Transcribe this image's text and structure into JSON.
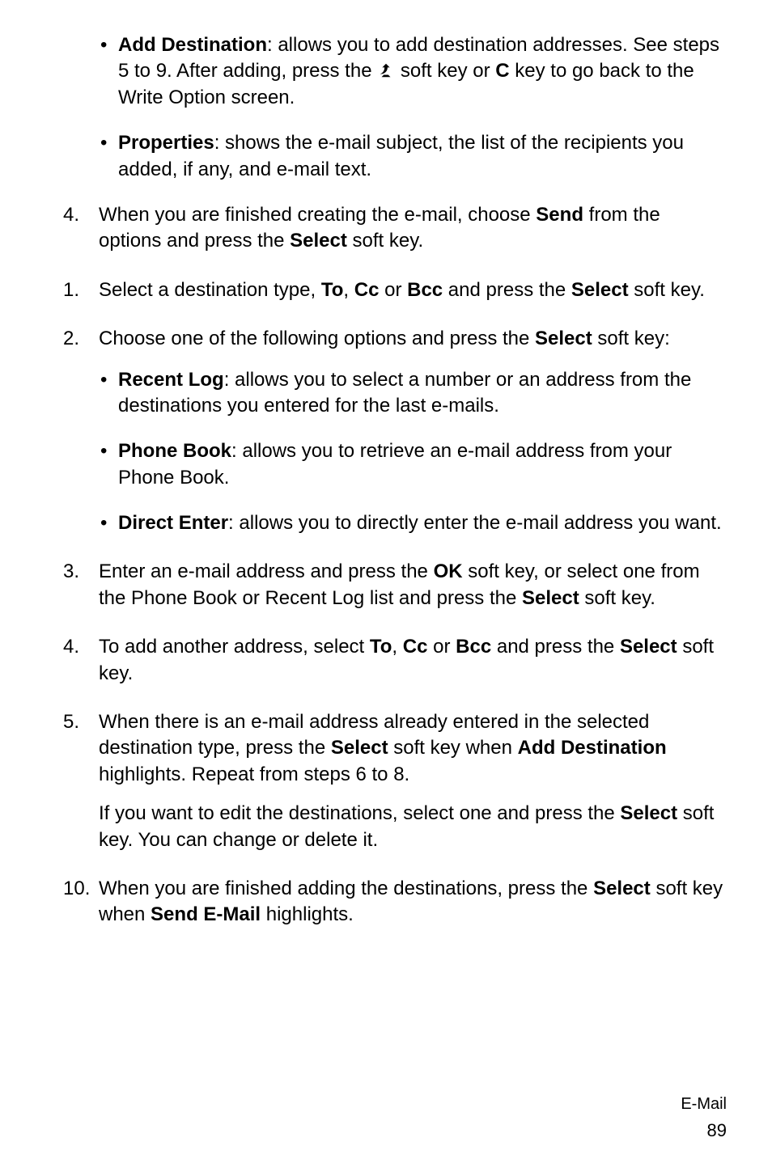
{
  "top_bullets": [
    {
      "title": "Add Destination",
      "tail1": ": allows you to add destination addresses. See steps 5 to 9. After adding, press the ",
      "tail2": " soft key or ",
      "key": "C",
      "tail3": " key to go back to the Write Option screen."
    },
    {
      "title": "Properties",
      "tail": ": shows the e-mail subject, the list of the recipients you added, if any, and e-mail text."
    }
  ],
  "step4": {
    "pre": "When you are finished creating the e-mail, choose ",
    "b1": "Send",
    "mid": " from the options and press the ",
    "b2": "Select",
    "post": " soft key."
  },
  "step5": {
    "pre": "Select a destination type, ",
    "b1": "To",
    "sep1": ", ",
    "b2": "Cc",
    "sep2": " or ",
    "b3": "Bcc",
    "mid": " and press the ",
    "b4": "Select",
    "post": " soft key."
  },
  "step6": {
    "pre": "Choose one of the following options and press the ",
    "b1": "Select",
    "post": " soft key:"
  },
  "step6_bullets": [
    {
      "title": "Recent Log",
      "tail": ": allows you to select a number or an address from the destinations you entered for the last e-mails."
    },
    {
      "title": "Phone Book",
      "tail": ": allows you to retrieve an e-mail address from your Phone Book."
    },
    {
      "title": "Direct Enter",
      "tail": ": allows you to directly enter the e-mail address you want."
    }
  ],
  "step7": {
    "pre": "Enter an e-mail address and press the ",
    "b1": "OK",
    "mid": " soft key, or select one from the Phone Book or Recent Log list and press the ",
    "b2": "Select",
    "post": " soft key."
  },
  "step8": {
    "pre": "To add another address, select ",
    "b1": "To",
    "sep1": ", ",
    "b2": "Cc",
    "sep2": " or ",
    "b3": "Bcc",
    "mid": " and press the ",
    "b4": "Select",
    "post": " soft key."
  },
  "step9": {
    "pre": "When there is an e-mail address already entered in the selected destination type, press the ",
    "b1": "Select",
    "mid": " soft key when ",
    "b2": "Add Destination",
    "post": " highlights. Repeat from steps 6 to 8."
  },
  "step9_follow": {
    "pre": "If you want to edit the destinations, select one and press the ",
    "b1": "Select",
    "post": " soft key. You can change or delete it."
  },
  "step10": {
    "pre": "When you are finished adding the destinations, press the ",
    "b1": "Select",
    "mid": " soft key when ",
    "b2": "Send E-Mail",
    "post": " highlights."
  },
  "footer": {
    "section": "E-Mail",
    "page": "89"
  }
}
